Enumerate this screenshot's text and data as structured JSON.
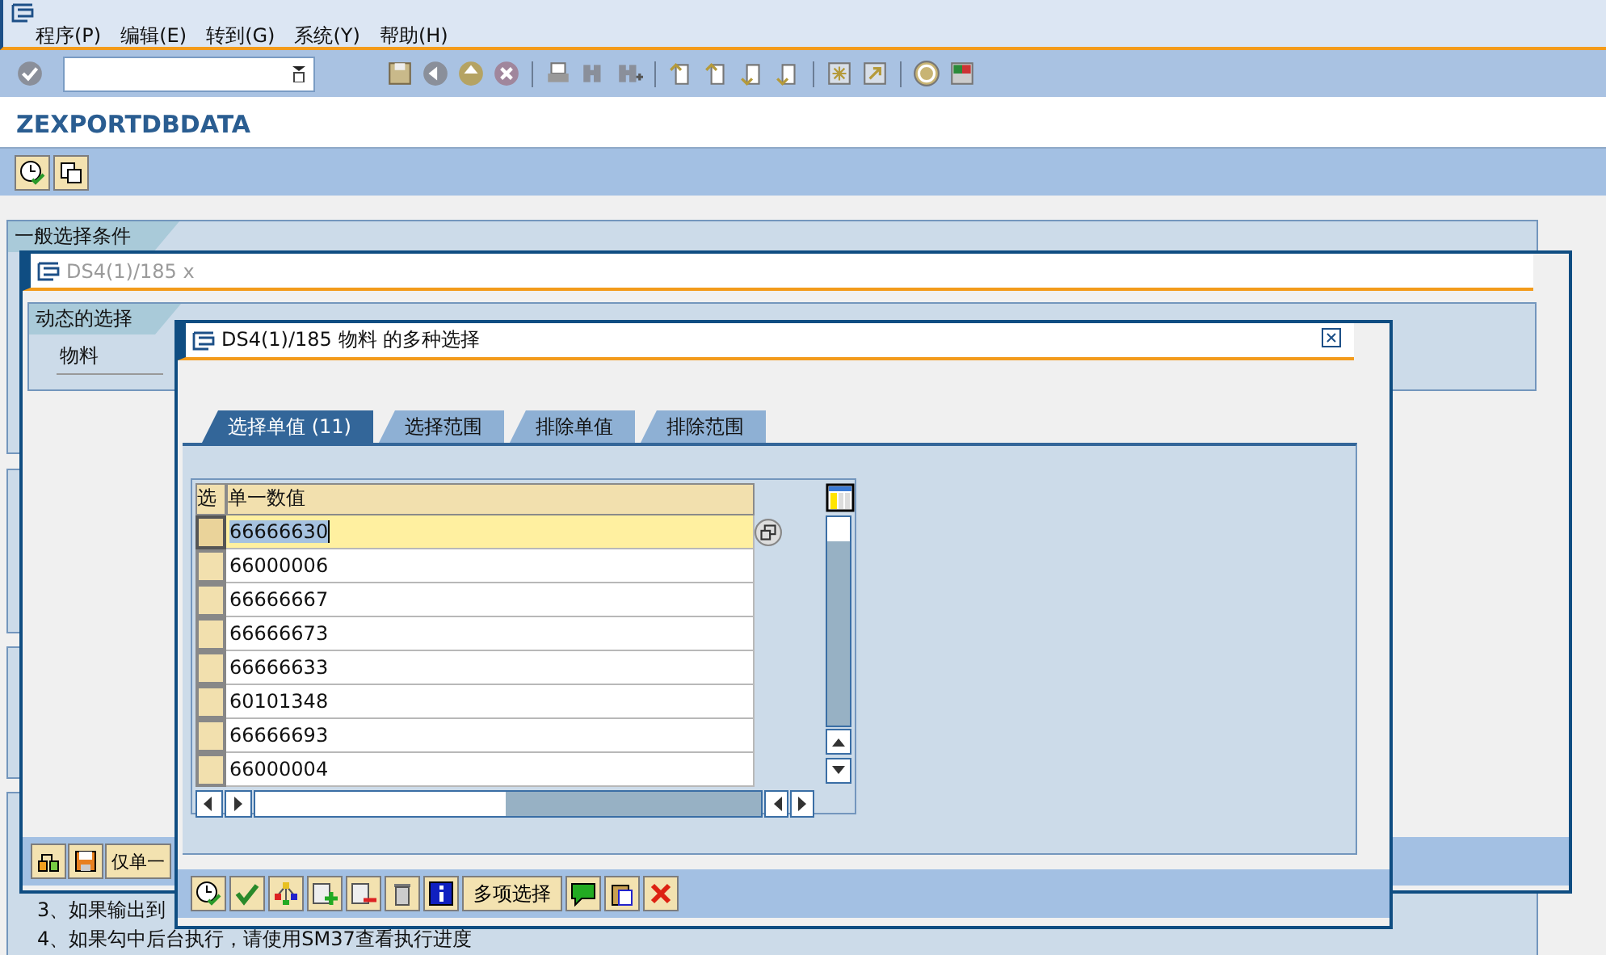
{
  "menu": [
    {
      "label": "程序(P)"
    },
    {
      "label": "编辑(E)"
    },
    {
      "label": "转到(G)"
    },
    {
      "label": "系统(Y)"
    },
    {
      "label": "帮助(H)"
    }
  ],
  "title": "ZEXPORTDBDATA",
  "selection_screen": {
    "group_title": "一般选择条件",
    "notes": [
      "3、如果输出到",
      "4、如果勾中后台执行，请使用SM37查看执行进度"
    ]
  },
  "dynamic_selection_window": {
    "title": "DS4(1)/185 x",
    "group_title": "动态的选择",
    "field_label": "物料",
    "toolbar_button": "仅单一"
  },
  "dialog": {
    "title": "DS4(1)/185 物料 的多种选择",
    "tabs": [
      {
        "label": "选择单值 (11)",
        "selected": true
      },
      {
        "label": "选择范围",
        "selected": false
      },
      {
        "label": "排除单值",
        "selected": false
      },
      {
        "label": "排除范围",
        "selected": false
      }
    ],
    "table": {
      "columns": [
        "选",
        "单一数值"
      ],
      "rows": [
        {
          "value": "66666630",
          "selected": true
        },
        {
          "value": "66000006",
          "selected": false
        },
        {
          "value": "66666667",
          "selected": false
        },
        {
          "value": "66666673",
          "selected": false
        },
        {
          "value": "66666633",
          "selected": false
        },
        {
          "value": "60101348",
          "selected": false
        },
        {
          "value": "66666693",
          "selected": false
        },
        {
          "value": "66000004",
          "selected": false
        }
      ]
    },
    "toolbar_button": "多项选择"
  }
}
